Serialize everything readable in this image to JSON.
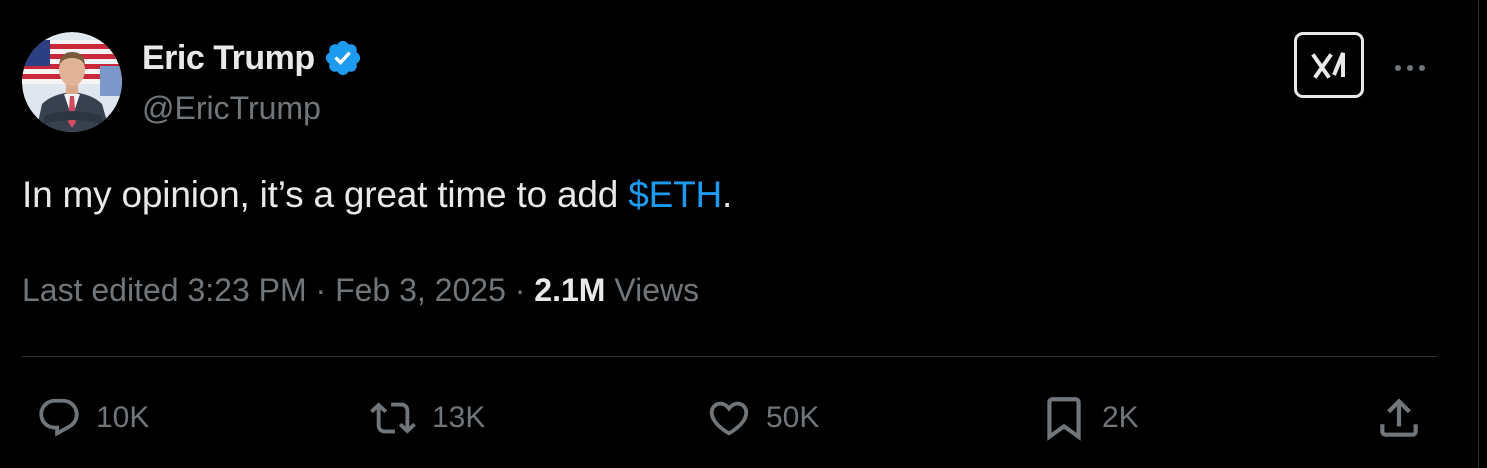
{
  "tweet": {
    "author": {
      "display_name": "Eric Trump",
      "handle": "@EricTrump",
      "verified": true,
      "avatar_icon": "profile-photo"
    },
    "text": {
      "before": "In my opinion, it’s a great time to add ",
      "cashtag": "$ETH",
      "after": "."
    },
    "meta": {
      "edited_label": "Last edited 3:23 PM",
      "separator": "·",
      "date": "Feb 3, 2025",
      "views_count": "2.1M",
      "views_label": "Views"
    },
    "actions": {
      "replies": "10K",
      "reposts": "13K",
      "likes": "50K",
      "bookmarks": "2K"
    }
  },
  "icons": {
    "grok": "grok-icon",
    "more": "more-icon",
    "reply": "reply-icon",
    "repost": "repost-icon",
    "like": "heart-icon",
    "bookmark": "bookmark-icon",
    "share": "share-icon",
    "verified": "verified-badge-icon"
  },
  "colors": {
    "background": "#000000",
    "text_primary": "#e7e9ea",
    "text_secondary": "#71767b",
    "accent": "#1d9bf0",
    "divider": "#2f3336"
  }
}
